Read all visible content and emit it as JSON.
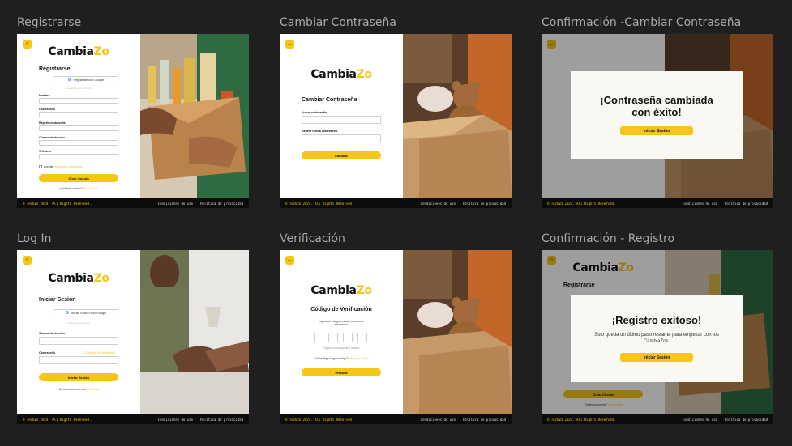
{
  "frames": {
    "registrarse": {
      "title": "Registrarse",
      "logo": {
        "a": "Cambia",
        "b": "Zo"
      },
      "heading": "Registrarse",
      "google_btn": "Regístrate con Google",
      "divider": "o regístrate con tu correo",
      "fields": [
        "Nombre",
        "Contraseña",
        "Repetir contraseña",
        "Correo electrónico",
        "Teléfono"
      ],
      "accept_text": "Aceptar",
      "accept_link": "términos y condiciones",
      "button": "Crear Cuenta",
      "login_prompt": "¿Ya tienes cuenta?",
      "login_link": "Inicia sesión"
    },
    "cambiar": {
      "title": "Cambiar Contraseña",
      "logo": {
        "a": "Cambia",
        "b": "Zo"
      },
      "heading": "Cambiar Contraseña",
      "fields": [
        "Nueva contraseña",
        "Repetir nueva contraseña"
      ],
      "button": "Cambiar"
    },
    "confirm_cambiar": {
      "title": "Confirmación -Cambiar Contraseña",
      "modal_title": "¡Contraseña cambiada con éxito!",
      "button": "Iniciar Sesión"
    },
    "login": {
      "title": "Log In",
      "logo": {
        "a": "Cambia",
        "b": "Zo"
      },
      "heading": "Iniciar Sesión",
      "google_btn": "Iniciar Sesión con Google",
      "divider": "o inicia con tu correo",
      "fields": [
        "Correo electrónico",
        "Contraseña"
      ],
      "forgot_link": "¿Olvidaste tu contraseña?",
      "button": "Iniciar Sesión",
      "signup_prompt": "¿No tienes una cuenta?",
      "signup_link": "Regístrate"
    },
    "verificacion": {
      "title": "Verificación",
      "logo": {
        "a": "Cambia",
        "b": "Zo"
      },
      "heading": "Código de Verificación",
      "instructions": "Ingresa el código enviado a tu correo electrónico",
      "code_hint": "Ingresa el código de 4 dígitos",
      "resend_prompt": "¿No te llegó ningún código?",
      "resend_link": "Reenviar código",
      "button": "Verificar"
    },
    "confirm_registro": {
      "title": "Confirmación - Registro",
      "bg_heading": "Registrarse",
      "modal_title": "¡Registro exitoso!",
      "modal_msg": "Solo queda un último paso restante para empezar con los CambiaZos.",
      "button": "Iniciar Sesión",
      "bg_button": "Crear Cuenta",
      "bg_login_prompt": "¿Ya tienes cuenta?",
      "bg_login_link": "Inicia sesión"
    }
  },
  "footer": {
    "copy": "© TecUZo 2024. All Rights Reserved.",
    "terms": "Condiciones de uso",
    "privacy": "Política de privacidad"
  },
  "icons": {
    "home": "home-icon",
    "back": "back-arrow-icon"
  },
  "colors": {
    "accent": "#f5c518",
    "background": "#1f1f1f",
    "footer": "#0c0c0c"
  }
}
